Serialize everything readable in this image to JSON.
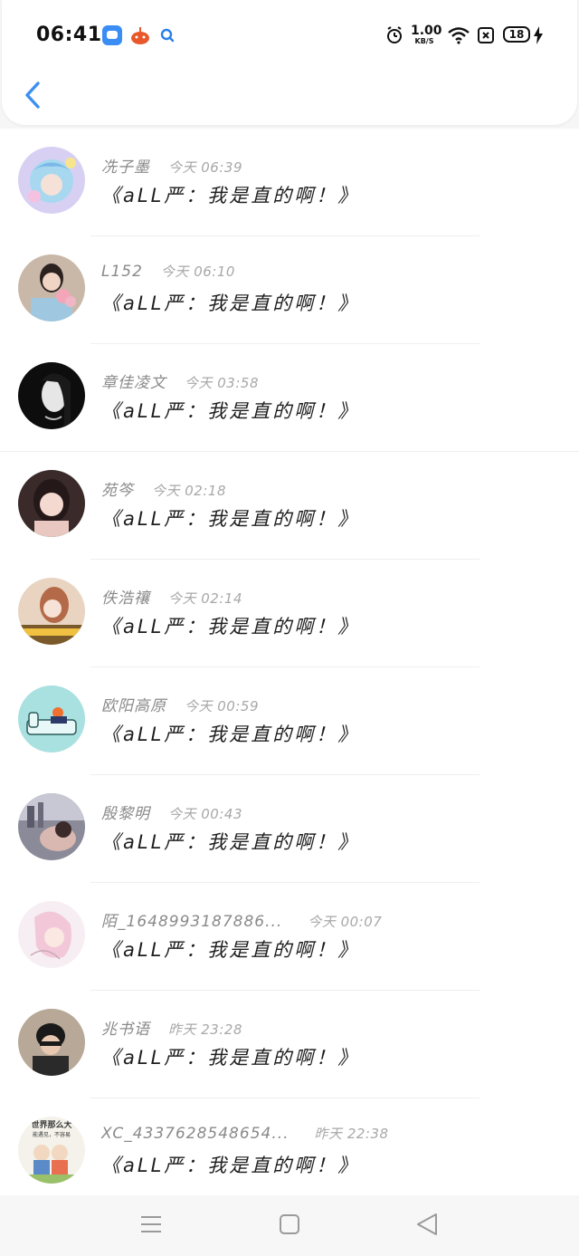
{
  "status_bar": {
    "time": "06:41",
    "speed_value": "1.00",
    "speed_unit": "KB/S",
    "battery": "18",
    "app_icons": [
      "blue-chat-app-icon",
      "orange-app-icon",
      "search-app-icon"
    ]
  },
  "header": {
    "back_icon": "chevron-left-icon",
    "accent_color": "#3d8ff0"
  },
  "messages": [
    {
      "name": "冼子墨",
      "time": "今天 06:39",
      "text": "《aLL严：我是直的啊！》"
    },
    {
      "name": "L152",
      "time": "今天 06:10",
      "text": "《aLL严：我是直的啊！》"
    },
    {
      "name": "章佳凌文",
      "time": "今天 03:58",
      "text": "《aLL严：我是直的啊！》"
    },
    {
      "name": "苑笒",
      "time": "今天 02:18",
      "text": "《aLL严：我是直的啊！》"
    },
    {
      "name": "佚浩禳",
      "time": "今天 02:14",
      "text": "《aLL严：我是直的啊！》"
    },
    {
      "name": "欧阳高原",
      "time": "今天 00:59",
      "text": "《aLL严：我是直的啊！》"
    },
    {
      "name": "殷黎明",
      "time": "今天 00:43",
      "text": "《aLL严：我是直的啊！》"
    },
    {
      "name": "陌_1648993187886...",
      "time": "今天 00:07",
      "text": "《aLL严：我是直的啊！》"
    },
    {
      "name": "兆书语",
      "time": "昨天 23:28",
      "text": "《aLL严：我是直的啊！》"
    },
    {
      "name": "XC_4337628548654...",
      "time": "昨天 22:38",
      "text": "《aLL严：我是直的啊！》"
    }
  ],
  "avatar_overlay_texts": {
    "row8_line1": "世界那么大",
    "row8_line2": "能遇见，不容易"
  },
  "navigation_bar": {
    "menu_icon": "menu-icon",
    "home_icon": "square-home-icon",
    "back_icon": "triangle-back-icon"
  }
}
